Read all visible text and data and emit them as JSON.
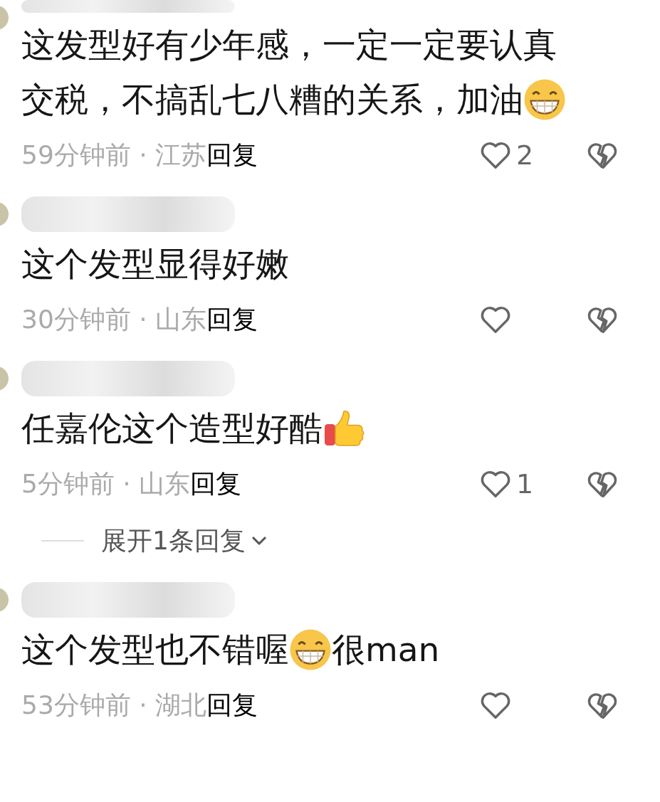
{
  "comments": [
    {
      "segments": [
        {
          "kind": "text",
          "text": "这发型好有少年感，一定一定要认真"
        },
        {
          "kind": "text",
          "text": "交税，不搞乱七八糟的关系，加油"
        },
        {
          "kind": "grin"
        }
      ],
      "time": "59分钟前 · 江苏",
      "reply": "回复",
      "likes": "2"
    },
    {
      "segments": [
        {
          "kind": "text",
          "text": "这个发型显得好嫩"
        }
      ],
      "time": "30分钟前 · 山东",
      "reply": "回复"
    },
    {
      "segments": [
        {
          "kind": "text",
          "text": "任嘉伦这个造型好酷"
        },
        {
          "kind": "thumb"
        }
      ],
      "time": "5分钟前 · 山东",
      "reply": "回复",
      "likes": "1",
      "expand": "展开1条回复"
    },
    {
      "segments": [
        {
          "kind": "text",
          "text": "这个发型也不错喔"
        },
        {
          "kind": "grin"
        },
        {
          "kind": "text",
          "text": "很man"
        }
      ],
      "time": "53分钟前 · 湖北",
      "reply": "回复"
    }
  ]
}
